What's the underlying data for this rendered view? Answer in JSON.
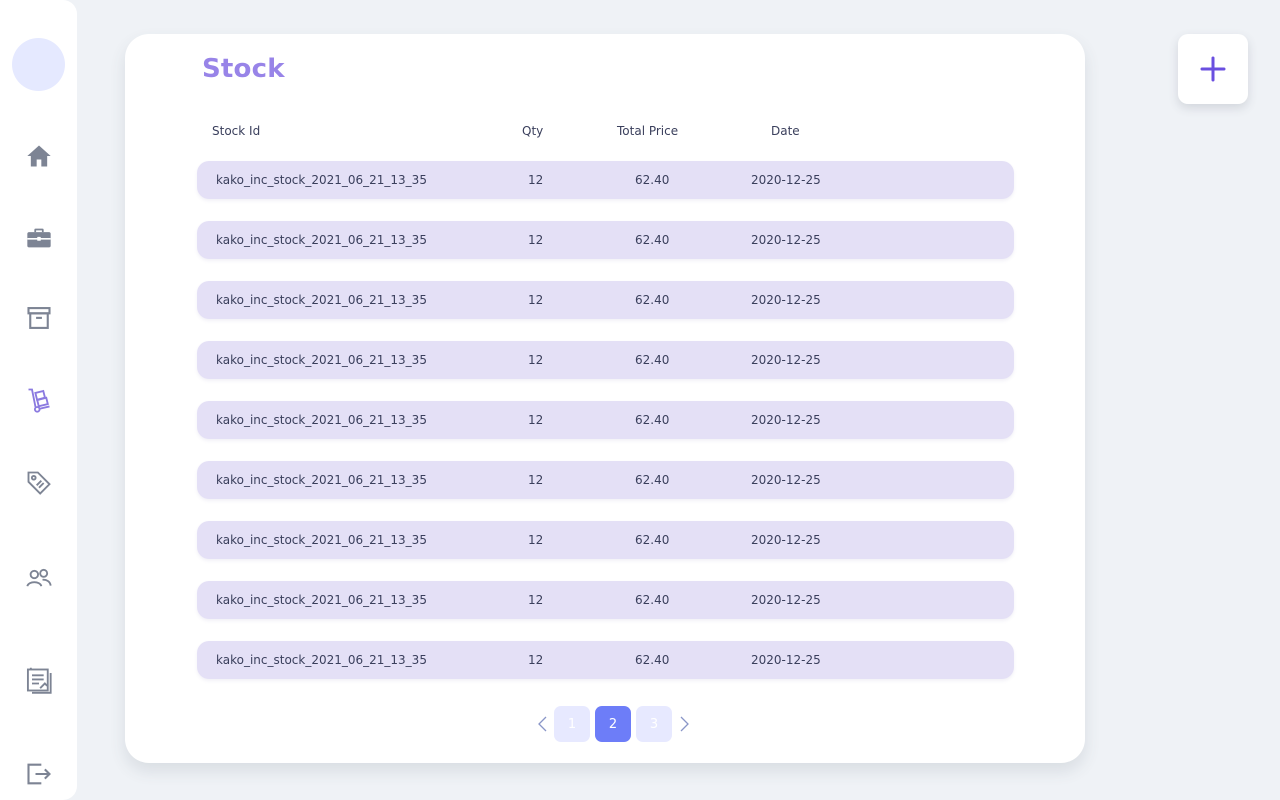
{
  "sidebar": {
    "items": [
      {
        "icon": "home-icon"
      },
      {
        "icon": "briefcase-icon"
      },
      {
        "icon": "archive-icon"
      },
      {
        "icon": "hand-truck-icon",
        "active": true
      },
      {
        "icon": "tag-icon"
      },
      {
        "icon": "users-icon"
      },
      {
        "icon": "notes-icon"
      },
      {
        "icon": "logout-icon"
      }
    ],
    "colors": {
      "default": "#7d8494",
      "active": "#8b7ae0"
    }
  },
  "page": {
    "title": "Stock"
  },
  "table": {
    "headers": {
      "id": "Stock Id",
      "qty": "Qty",
      "price": "Total Price",
      "date": "Date"
    },
    "rows": [
      {
        "id": "kako_inc_stock_2021_06_21_13_35",
        "qty": "12",
        "price": "62.40",
        "date": "2020-12-25"
      },
      {
        "id": "kako_inc_stock_2021_06_21_13_35",
        "qty": "12",
        "price": "62.40",
        "date": "2020-12-25"
      },
      {
        "id": "kako_inc_stock_2021_06_21_13_35",
        "qty": "12",
        "price": "62.40",
        "date": "2020-12-25"
      },
      {
        "id": "kako_inc_stock_2021_06_21_13_35",
        "qty": "12",
        "price": "62.40",
        "date": "2020-12-25"
      },
      {
        "id": "kako_inc_stock_2021_06_21_13_35",
        "qty": "12",
        "price": "62.40",
        "date": "2020-12-25"
      },
      {
        "id": "kako_inc_stock_2021_06_21_13_35",
        "qty": "12",
        "price": "62.40",
        "date": "2020-12-25"
      },
      {
        "id": "kako_inc_stock_2021_06_21_13_35",
        "qty": "12",
        "price": "62.40",
        "date": "2020-12-25"
      },
      {
        "id": "kako_inc_stock_2021_06_21_13_35",
        "qty": "12",
        "price": "62.40",
        "date": "2020-12-25"
      },
      {
        "id": "kako_inc_stock_2021_06_21_13_35",
        "qty": "12",
        "price": "62.40",
        "date": "2020-12-25"
      }
    ]
  },
  "pagination": {
    "pages": [
      "1",
      "2",
      "3"
    ],
    "current": "2",
    "prev_icon": "chevron-left-icon",
    "next_icon": "chevron-right-icon"
  },
  "add_button": {
    "icon": "plus-icon",
    "color": "#6a4fe0"
  }
}
